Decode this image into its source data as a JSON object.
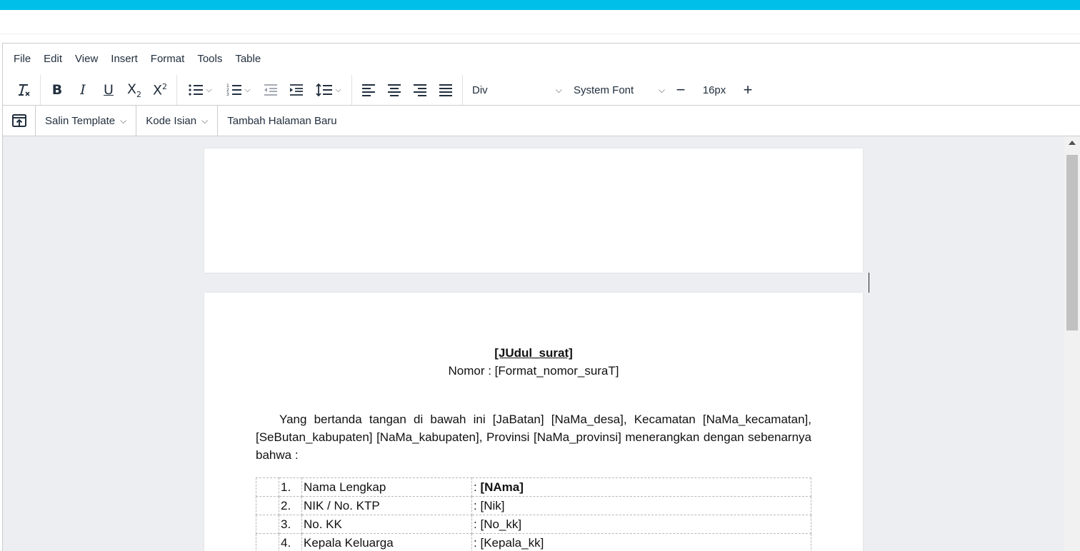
{
  "menubar": [
    "File",
    "Edit",
    "View",
    "Insert",
    "Format",
    "Tools",
    "Table"
  ],
  "toolbar": {
    "block_format": "Div",
    "font_family": "System Font",
    "font_size": "16px",
    "minus": "−",
    "plus": "+"
  },
  "toolbar2": {
    "copy_template": "Salin Template",
    "field_code": "Kode Isian",
    "add_page": "Tambah Halaman Baru"
  },
  "document": {
    "title": "[JUdul_surat]",
    "nomor": "Nomor : [Format_nomor_suraT]",
    "paragraph": "Yang bertanda tangan di bawah ini [JaBatan] [NaMa_desa], Kecamatan [NaMa_kecamatan], [SeButan_kabupaten] [NaMa_kabupaten], Provinsi [NaMa_provinsi] menerangkan dengan sebenarnya bahwa :",
    "rows": [
      {
        "no": "1.",
        "label": "Nama Lengkap",
        "sep": ":",
        "value": "[NAma]"
      },
      {
        "no": "2.",
        "label": "NIK / No. KTP",
        "sep": ":",
        "value": "[Nik]"
      },
      {
        "no": "3.",
        "label": "No. KK",
        "sep": ":",
        "value": "[No_kk]"
      },
      {
        "no": "4.",
        "label": "Kepala Keluarga",
        "sep": ":",
        "value": "[Kepala_kk]"
      }
    ]
  }
}
